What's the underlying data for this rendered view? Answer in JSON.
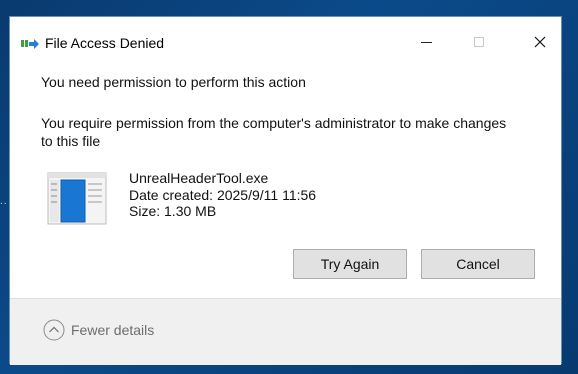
{
  "desktop": {
    "fragment_text": ".."
  },
  "dialog": {
    "title": "File Access Denied",
    "primary_message": "You need permission to perform this action",
    "secondary_message": "You require permission from the computer's administrator to make changes to this file",
    "file": {
      "name": "UnrealHeaderTool.exe",
      "date_created": "Date created: 2025/9/11 11:56",
      "size": "Size: 1.30 MB",
      "icon": "exe-file-icon"
    },
    "buttons": {
      "try_again": "Try Again",
      "cancel": "Cancel"
    },
    "footer": {
      "fewer_details": "Fewer details",
      "icon": "chevron-up-circle-icon"
    },
    "titlebar_icons": {
      "minimize": "minimize-icon",
      "maximize": "maximize-icon",
      "close": "close-icon"
    }
  },
  "colors": {
    "desktop_bg": "#0b4a8a",
    "dialog_bg": "#ffffff",
    "footer_bg": "#f0f0f0",
    "button_bg": "#e1e1e1"
  }
}
